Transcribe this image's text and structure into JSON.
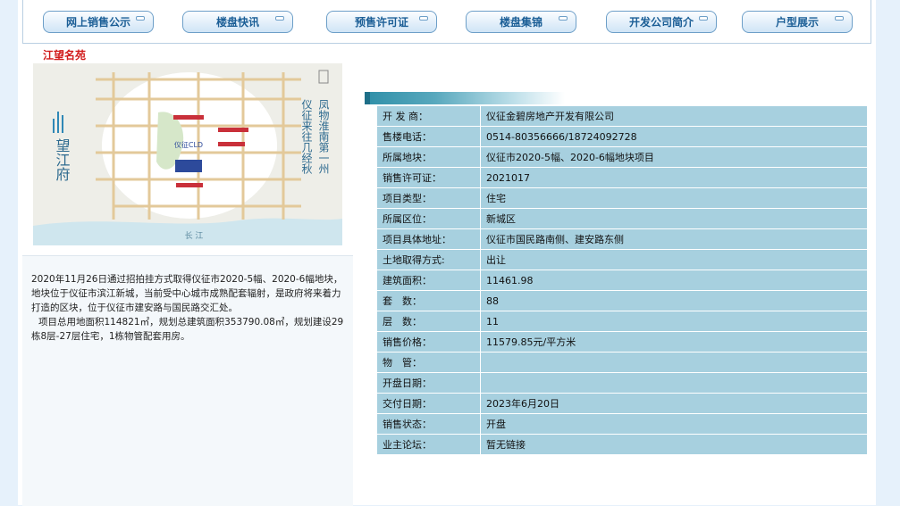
{
  "nav": [
    {
      "label": "网上销售公示"
    },
    {
      "label": "楼盘快讯"
    },
    {
      "label": "预售许可证"
    },
    {
      "label": "楼盘集锦"
    },
    {
      "label": "开发公司简介"
    },
    {
      "label": "户型展示"
    }
  ],
  "project_title": "江望名苑",
  "map": {
    "logo_text": "望江府",
    "slogan_right": "凤物淮南第一州",
    "slogan_left": "仪征来往几经秋",
    "river_label": "长 江",
    "center_label": "仪征CLD"
  },
  "description": {
    "p1": "2020年11月26日通过招拍挂方式取得仪征市2020-5幅、2020-6幅地块，地块位于仪征市滨江新城，当前受中心城市成熟配套辐射，是政府将来着力打造的区块，位于仪征市建安路与国民路交汇处。",
    "p2": "项目总用地面积114821㎡，规划总建筑面积353790.08㎡，规划建设29栋8层-27层住宅，1栋物管配套用房。"
  },
  "info": [
    {
      "k": "开 发 商：",
      "v": "仪征金碧房地产开发有限公司"
    },
    {
      "k": "售楼电话：",
      "v": "0514-80356666/18724092728"
    },
    {
      "k": "所属地块：",
      "v": "仪征市2020-5幅、2020-6幅地块项目"
    },
    {
      "k": "销售许可证：",
      "v": "2021017"
    },
    {
      "k": "项目类型：",
      "v": "住宅"
    },
    {
      "k": "所属区位：",
      "v": "新城区"
    },
    {
      "k": "项目具体地址：",
      "v": "仪征市国民路南侧、建安路东侧"
    },
    {
      "k": "土地取得方式:",
      "v": "出让"
    },
    {
      "k": "建筑面积：",
      "v": "11461.98"
    },
    {
      "k": "套　数：",
      "v": "88"
    },
    {
      "k": "层　数：",
      "v": "11"
    },
    {
      "k": "销售价格：",
      "v": "11579.85元/平方米"
    },
    {
      "k": "物　管：",
      "v": ""
    },
    {
      "k": "开盘日期：",
      "v": ""
    },
    {
      "k": "交付日期：",
      "v": "2023年6月20日"
    },
    {
      "k": "销售状态：",
      "v": "开盘"
    },
    {
      "k": "业主论坛：",
      "v": "暂无链接"
    }
  ]
}
